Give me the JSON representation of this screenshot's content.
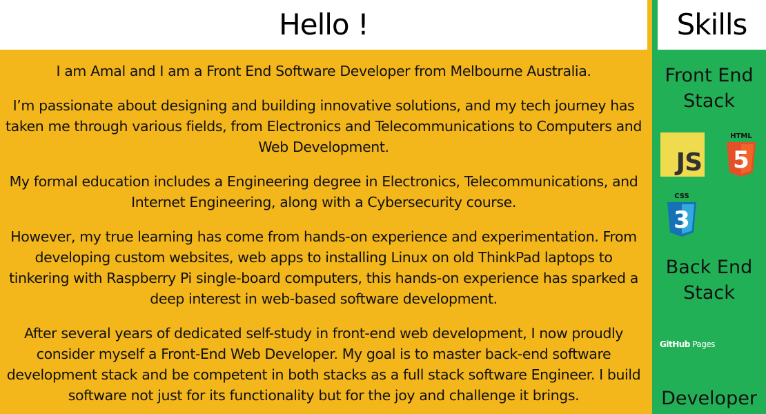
{
  "main": {
    "title": "Hello !",
    "paragraphs": [
      "I am Amal and I am a Front End Software Developer from Melbourne Australia.",
      "I’m passionate about designing and building innovative solutions, and my tech journey has taken me through various fields, from Electronics and Telecommunications to Computers and Web Development.",
      "My formal education includes a Engineering degree in Electronics, Telecommunications, and Internet Engineering, along with a Cybersecurity course.",
      "However, my true learning has come from hands-on experience and experimentation. From developing custom websites, web apps to installing Linux on old ThinkPad laptops to tinkering with Raspberry Pi single-board computers, this hands-on experience has sparked a deep interest in web-based software development.",
      "After several years of dedicated self-study in front-end web development, I now proudly consider myself a Front-End Web Developer. My goal is to master back-end software development stack and be competent in both stacks as a full stack software Engineer. I build software not just for its functionality but for the joy and challenge it brings."
    ]
  },
  "sidebar": {
    "title": "Skills",
    "front_end": {
      "title": "Front End Stack"
    },
    "back_end": {
      "title": "Back End Stack"
    },
    "developer": {
      "title": "Developer"
    },
    "icons": {
      "js": {
        "name": "javascript-icon",
        "label": "JS"
      },
      "html": {
        "name": "html5-icon",
        "label": "HTML",
        "digit": "5"
      },
      "css": {
        "name": "css3-icon",
        "label": "CSS",
        "digit": "3"
      },
      "github_pages": {
        "name": "github-pages-icon",
        "brand": "GitHub",
        "word": "Pages"
      }
    }
  },
  "colors": {
    "main_bg": "#f3b61b",
    "sidebar_bg": "#22b057",
    "header_bg": "#ffffff",
    "js_yellow": "#f0db4f",
    "html_orange": "#e34f26",
    "css_blue": "#1572b6"
  }
}
